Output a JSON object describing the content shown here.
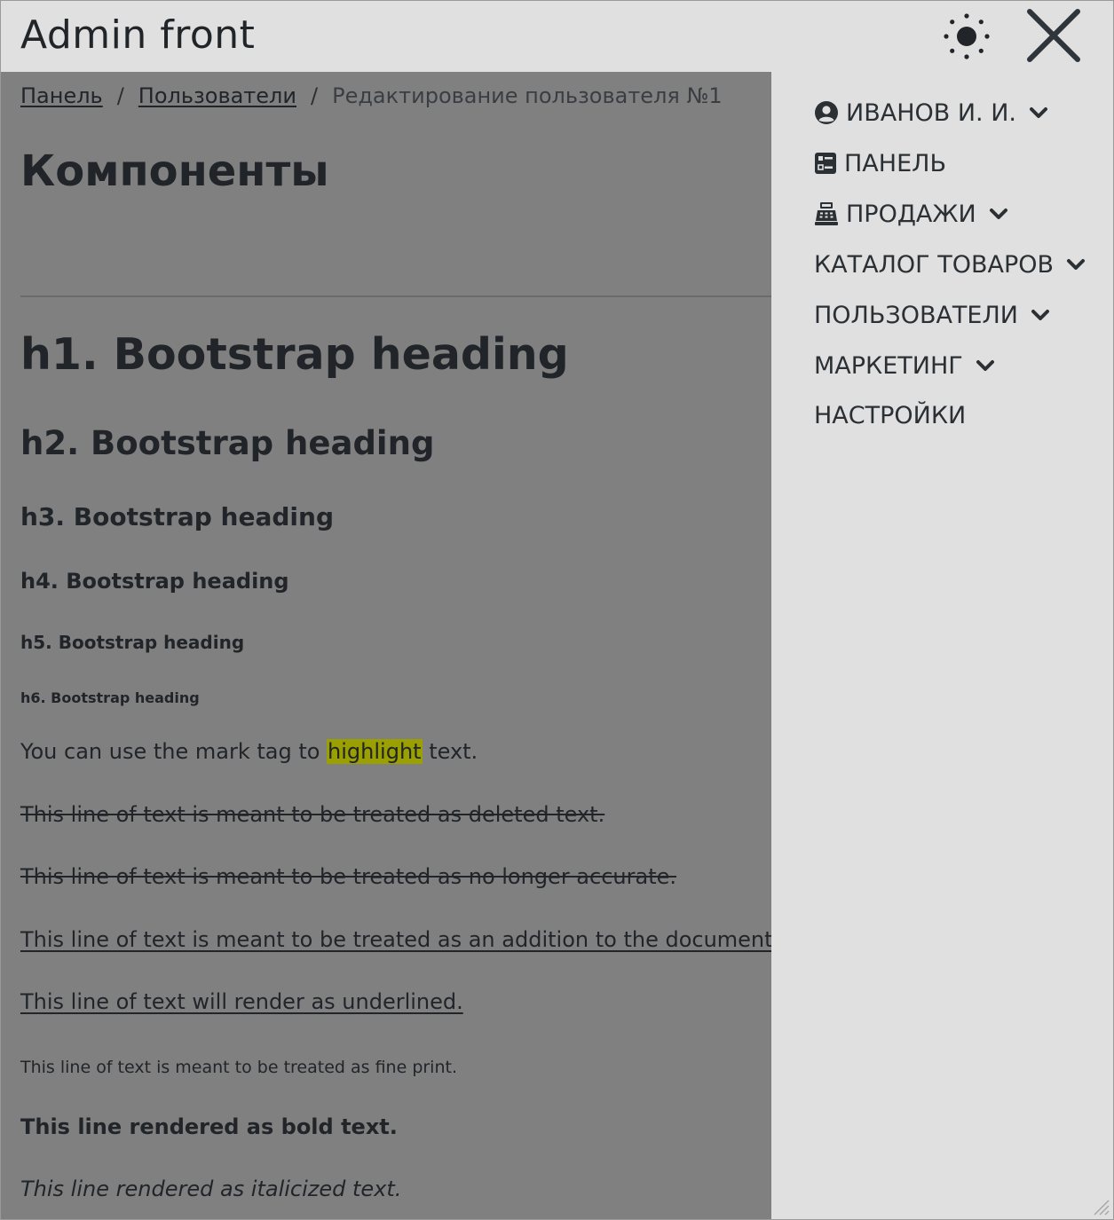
{
  "app": {
    "title": "Admin front"
  },
  "breadcrumb": {
    "items": [
      "Панель",
      "Пользователи"
    ],
    "separator": "/",
    "current": "Редактирование пользователя №1"
  },
  "page": {
    "title": "Компоненты"
  },
  "headings": {
    "h1": "h1. Bootstrap heading",
    "h2": "h2. Bootstrap heading",
    "h3": "h3. Bootstrap heading",
    "h4": "h4. Bootstrap heading",
    "h5": "h5. Bootstrap heading",
    "h6": "h6. Bootstrap heading"
  },
  "text": {
    "mark_before": "You can use the mark tag to ",
    "mark_word": "highlight",
    "mark_after": " text.",
    "deleted": "This line of text is meant to be treated as deleted text.",
    "no_longer_accurate": "This line of text is meant to be treated as no longer accurate.",
    "addition": "This line of text is meant to be treated as an addition to the document.",
    "underlined": "This line of text will render as underlined.",
    "fine_print": "This line of text is meant to be treated as fine print.",
    "bold": "This line rendered as bold text.",
    "italic": "This line rendered as italicized text."
  },
  "sidebar": {
    "items": [
      {
        "label": "Иванов И. И.",
        "icon": "user-circle-icon",
        "has_dropdown": true
      },
      {
        "label": "Панель",
        "icon": "dashboard-icon",
        "has_dropdown": false
      },
      {
        "label": "Продажи",
        "icon": "cash-register-icon",
        "has_dropdown": true
      },
      {
        "label": "Каталог товаров",
        "icon": "",
        "has_dropdown": true
      },
      {
        "label": "Пользователи",
        "icon": "",
        "has_dropdown": true
      },
      {
        "label": "Маркетинг",
        "icon": "",
        "has_dropdown": true
      },
      {
        "label": "Настройки",
        "icon": "",
        "has_dropdown": false
      }
    ]
  },
  "colors": {
    "header_bg": "#e0e0e0",
    "main_overlay_bg": "#808080",
    "sidebar_bg": "#e0e0e0",
    "text": "#212529",
    "highlight": "#99a000"
  },
  "icons": {
    "theme": "sun-icon",
    "close": "close-icon",
    "dropdown": "chevron-down-icon"
  }
}
